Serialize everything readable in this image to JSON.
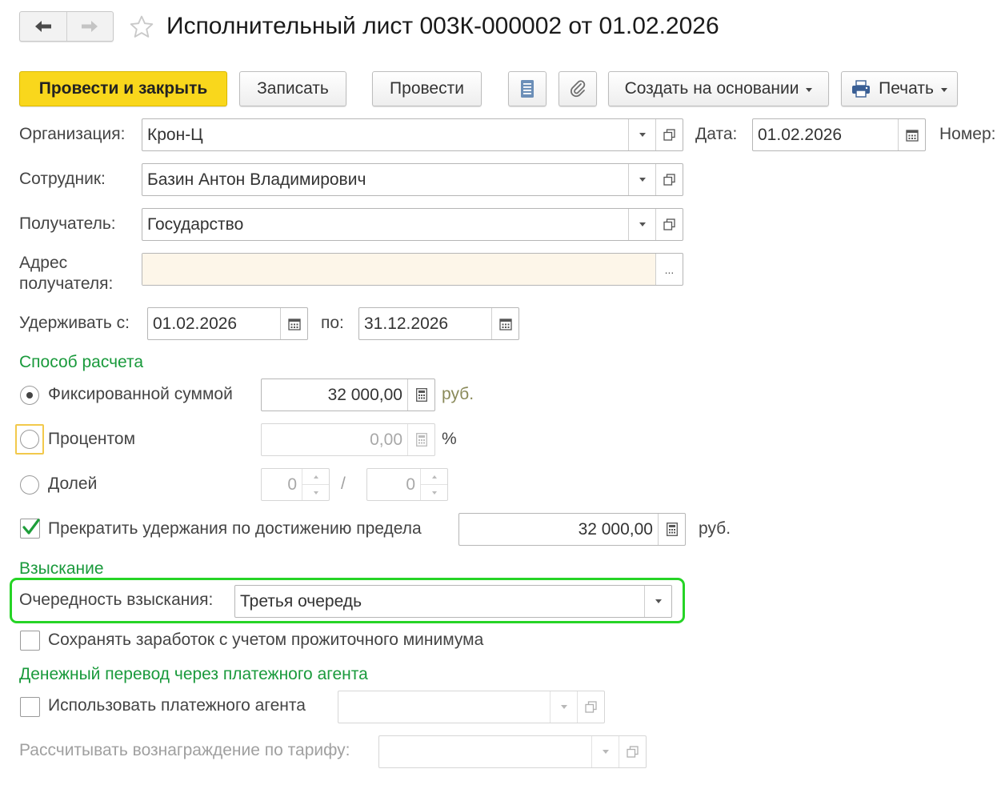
{
  "header": {
    "title": "Исполнительный лист 003К-000002 от 01.02.2026"
  },
  "toolbar": {
    "post_and_close": "Провести и закрыть",
    "save": "Записать",
    "post": "Провести",
    "create_based_on": "Создать на основании",
    "print": "Печать"
  },
  "form": {
    "organization": {
      "label": "Организация:",
      "value": "Крон-Ц"
    },
    "date": {
      "label": "Дата:",
      "value": "01.02.2026"
    },
    "number": {
      "label": "Номер:"
    },
    "employee": {
      "label": "Сотрудник:",
      "value": "Базин Антон Владимирович"
    },
    "recipient": {
      "label": "Получатель:",
      "value": "Государство"
    },
    "recipient_address": {
      "label_line1": "Адрес",
      "label_line2": "получателя:",
      "value": "",
      "ellipsis": "..."
    },
    "withhold_from": {
      "label": "Удерживать с:",
      "value": "01.02.2026"
    },
    "withhold_to": {
      "label": "по:",
      "value": "31.12.2026"
    }
  },
  "calc_method": {
    "section_title": "Способ расчета",
    "fixed": {
      "label": "Фиксированной суммой",
      "value": "32 000,00",
      "unit": "руб.",
      "selected": true
    },
    "percent": {
      "label": "Процентом",
      "value": "0,00",
      "unit": "%"
    },
    "share": {
      "label": "Долей",
      "numerator": "0",
      "separator": "/",
      "denominator": "0"
    },
    "limit": {
      "label": "Прекратить удержания по достижению предела",
      "checked": true,
      "value": "32 000,00",
      "unit": "руб."
    }
  },
  "collection": {
    "section_title": "Взыскание",
    "priority": {
      "label": "Очередность взыскания:",
      "value": "Третья очередь"
    },
    "subsistence": {
      "label": "Сохранять заработок с учетом прожиточного минимума",
      "checked": false
    }
  },
  "payment_agent": {
    "section_title": "Денежный перевод через платежного агента",
    "use_agent": {
      "label": "Использовать платежного агента",
      "checked": false,
      "value": ""
    },
    "tariff": {
      "label": "Рассчитывать вознаграждение по тарифу:",
      "value": ""
    }
  },
  "colors": {
    "accent_yellow": "#f9d71c",
    "section_green": "#1a9a3c",
    "highlight_green": "#26d426",
    "address_fill": "#fdf6e9"
  }
}
